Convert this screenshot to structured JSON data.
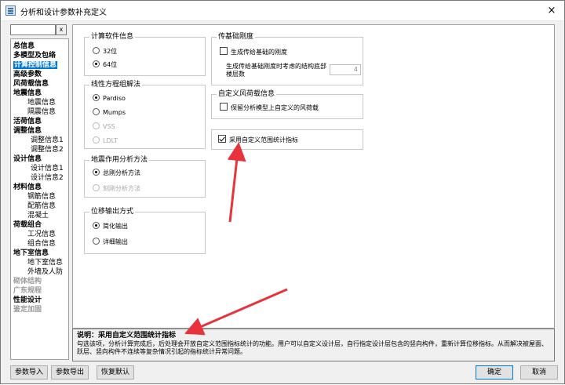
{
  "window": {
    "title": "分析和设计参数补充定义",
    "close": "×"
  },
  "nav": {
    "search_value": "",
    "clear_label": "x",
    "items": [
      {
        "label": "总信息",
        "level": 0
      },
      {
        "label": "多模型及包络",
        "level": 0
      },
      {
        "label": "计算控制信息",
        "level": 0,
        "selected": true
      },
      {
        "label": "高级参数",
        "level": 0
      },
      {
        "label": "风荷载信息",
        "level": 0
      },
      {
        "label": "地震信息",
        "level": 0
      },
      {
        "label": "地震信息",
        "level": 1
      },
      {
        "label": "隔震信息",
        "level": 1
      },
      {
        "label": "活荷信息",
        "level": 0
      },
      {
        "label": "调整信息",
        "level": 0
      },
      {
        "label": "调整信息1",
        "level": 2
      },
      {
        "label": "调整信息2",
        "level": 2
      },
      {
        "label": "设计信息",
        "level": 0
      },
      {
        "label": "设计信息1",
        "level": 2
      },
      {
        "label": "设计信息2",
        "level": 2
      },
      {
        "label": "材料信息",
        "level": 0
      },
      {
        "label": "钢筋信息",
        "level": 1
      },
      {
        "label": "配筋信息",
        "level": 1
      },
      {
        "label": "混凝土",
        "level": 1
      },
      {
        "label": "荷载组合",
        "level": 0
      },
      {
        "label": "工况信息",
        "level": 1
      },
      {
        "label": "组合信息",
        "level": 1
      },
      {
        "label": "地下室信息",
        "level": 0
      },
      {
        "label": "地下室信息",
        "level": 1
      },
      {
        "label": "外墙及人防",
        "level": 1
      },
      {
        "label": "砌体结构",
        "level": 0,
        "disabled": true
      },
      {
        "label": "广东规程",
        "level": 0,
        "disabled": true
      },
      {
        "label": "性能设计",
        "level": 0
      },
      {
        "label": "鉴定加固",
        "level": 0,
        "disabled": true
      }
    ]
  },
  "software": {
    "title": "计算软件信息",
    "options": [
      {
        "label": "32位",
        "checked": false
      },
      {
        "label": "64位",
        "checked": true
      }
    ]
  },
  "solver": {
    "title": "线性方程组解法",
    "options": [
      {
        "label": "Pardiso",
        "checked": true,
        "disabled": false
      },
      {
        "label": "Mumps",
        "checked": false,
        "disabled": false
      },
      {
        "label": "VSS",
        "checked": false,
        "disabled": true
      },
      {
        "label": "LDLT",
        "checked": false,
        "disabled": true
      }
    ]
  },
  "seismic": {
    "title": "地震作用分析方法",
    "options": [
      {
        "label": "总刚分析方法",
        "checked": true,
        "disabled": false
      },
      {
        "label": "刻刚分析方法",
        "checked": false,
        "disabled": true
      }
    ]
  },
  "displacement": {
    "title": "位移输出方式",
    "options": [
      {
        "label": "简化输出",
        "checked": true
      },
      {
        "label": "详细输出",
        "checked": false
      }
    ]
  },
  "foundation": {
    "title": "传基础刚度",
    "check1": "生成传给基础的刚度",
    "label2": "生成传给基础刚度时考虑的结构底部楼层数",
    "floors_value": "4"
  },
  "wind": {
    "title": "自定义风荷载信息",
    "check1": "保留分析模型上自定义的风荷载"
  },
  "custom_stat": {
    "label": "采用自定义范围统计指标",
    "checked": true
  },
  "description": {
    "title": "说明：采用自定义范围统计指标",
    "body": "勾选该项，分析计算完成后，后处理会开放自定义范围指标统计的功能。用户可以自定义设计层，自行指定设计层包含的竖向构件，重新计算位移指标。从而解决被屋面、跃层、竖向构件不连续等复杂情况引起的指标统计异常问题。"
  },
  "buttons": {
    "import": "参数导入",
    "export": "参数导出",
    "restore": "恢复默认",
    "ok": "确定",
    "cancel": "取消"
  },
  "annotation_color": "#e8323c"
}
